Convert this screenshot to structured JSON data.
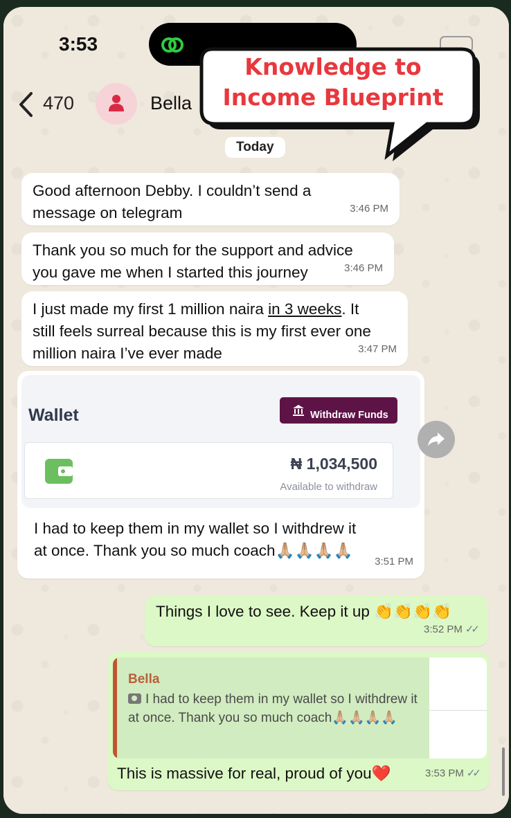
{
  "status": {
    "time": "3:53"
  },
  "header": {
    "back_count": "470",
    "contact_name": "Bella"
  },
  "banner": {
    "line1": "Knowledge to",
    "line2": "Income Blueprint"
  },
  "date_chip": "Today",
  "messages": [
    {
      "text1": "Good afternoon Debby. I couldn’t send a",
      "text2": "message on telegram",
      "time": "3:46 PM"
    },
    {
      "text1": "Thank you so much for the support and advice",
      "text2": "you gave me when I started this journey",
      "time": "3:46 PM"
    },
    {
      "text1a": "I just made my first 1 million naira ",
      "text1b": "in 3 weeks",
      "text1c": ". It",
      "text2": "still feels surreal because this is my first ever one",
      "text3": "million naira I’ve ever made",
      "time": "3:47 PM"
    }
  ],
  "wallet": {
    "title": "Wallet",
    "button": "Withdraw Funds",
    "amount": "₦ 1,034,500",
    "available": "Available to withdraw",
    "caption1": "I had to keep them in my wallet so I withdrew it",
    "caption2": "at once. Thank you so much coach🙏🏼🙏🏼🙏🏼🙏🏼",
    "time": "3:51 PM"
  },
  "outgoing": [
    {
      "text": "Things I love to see. Keep it up 👏👏👏👏",
      "time": "3:52 PM",
      "ticks": "✓✓"
    },
    {
      "text": "This is massive for real, proud of you❤️",
      "time": "3:53 PM",
      "ticks": "✓✓"
    }
  ],
  "reply": {
    "name": "Bella",
    "text": "I had to keep them in my wallet so I withdrew it at once. Thank you so much coach🙏🏼🙏🏼🙏🏼🙏🏼"
  },
  "colors": {
    "outgoing_bubble": "#dcf8c6",
    "banner_text": "#e8383d",
    "withdraw_button": "#5e1346",
    "wallet_icon": "#6cbf5f"
  },
  "icons": [
    "back-chevron-icon",
    "person-icon",
    "bank-icon",
    "wallet-icon",
    "forward-icon",
    "camera-icon",
    "double-check-icon",
    "link-icon"
  ]
}
